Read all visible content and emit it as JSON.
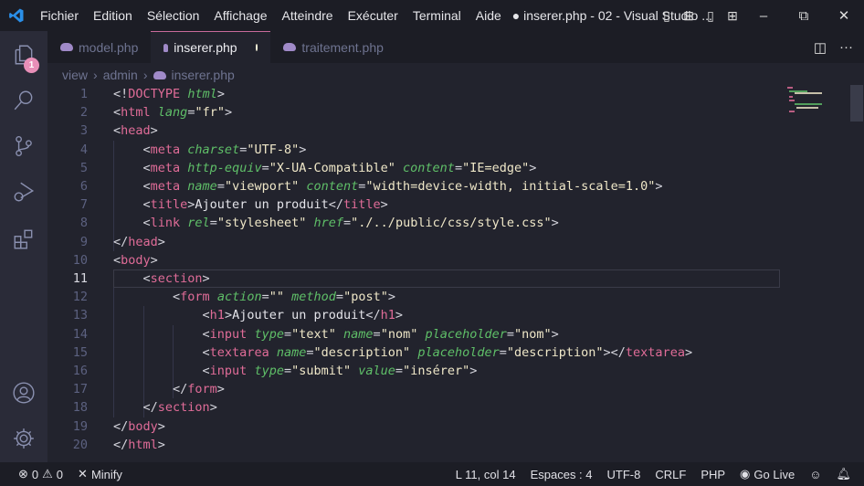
{
  "titlebar": {
    "menu": [
      "Fichier",
      "Edition",
      "Sélection",
      "Affichage",
      "Atteindre",
      "Exécuter",
      "Terminal",
      "Aide"
    ],
    "window_title": "● inserer.php - 02 - Visual Studio ..."
  },
  "activity": {
    "explorer_badge": "1"
  },
  "tabs": [
    {
      "label": "model.php"
    },
    {
      "label": "inserer.php",
      "modified": true
    },
    {
      "label": "traitement.php"
    }
  ],
  "breadcrumb": [
    "view",
    "admin",
    "inserer.php"
  ],
  "colors": {
    "tag": "#e06c98",
    "attr": "#5fbf68",
    "string": "#efe7c8",
    "accent": "#c86a9a"
  },
  "editor": {
    "current_line": 11,
    "lines": [
      [
        [
          "p",
          "<!"
        ],
        [
          "tag",
          "DOCTYPE"
        ],
        [
          "p",
          " "
        ],
        [
          "attr",
          "html"
        ],
        [
          "p",
          ">"
        ]
      ],
      [
        [
          "p",
          "<"
        ],
        [
          "tag",
          "html"
        ],
        [
          "p",
          " "
        ],
        [
          "attr",
          "lang"
        ],
        [
          "p",
          "="
        ],
        [
          "str",
          "\"fr\""
        ],
        [
          "p",
          ">"
        ]
      ],
      [
        [
          "p",
          "<"
        ],
        [
          "tag",
          "head"
        ],
        [
          "p",
          ">"
        ]
      ],
      [
        [
          "p",
          "    <"
        ],
        [
          "tag",
          "meta"
        ],
        [
          "p",
          " "
        ],
        [
          "attr",
          "charset"
        ],
        [
          "p",
          "="
        ],
        [
          "str",
          "\"UTF-8\""
        ],
        [
          "p",
          ">"
        ]
      ],
      [
        [
          "p",
          "    <"
        ],
        [
          "tag",
          "meta"
        ],
        [
          "p",
          " "
        ],
        [
          "attr",
          "http-equiv"
        ],
        [
          "p",
          "="
        ],
        [
          "str",
          "\"X-UA-Compatible\""
        ],
        [
          "p",
          " "
        ],
        [
          "attr",
          "content"
        ],
        [
          "p",
          "="
        ],
        [
          "str",
          "\"IE=edge\""
        ],
        [
          "p",
          ">"
        ]
      ],
      [
        [
          "p",
          "    <"
        ],
        [
          "tag",
          "meta"
        ],
        [
          "p",
          " "
        ],
        [
          "attr",
          "name"
        ],
        [
          "p",
          "="
        ],
        [
          "str",
          "\"viewport\""
        ],
        [
          "p",
          " "
        ],
        [
          "attr",
          "content"
        ],
        [
          "p",
          "="
        ],
        [
          "str",
          "\"width=device-width, initial-scale=1.0\""
        ],
        [
          "p",
          ">"
        ]
      ],
      [
        [
          "p",
          "    <"
        ],
        [
          "tag",
          "title"
        ],
        [
          "p",
          ">"
        ],
        [
          "txt",
          "Ajouter un produit"
        ],
        [
          "p",
          "</"
        ],
        [
          "tag",
          "title"
        ],
        [
          "p",
          ">"
        ]
      ],
      [
        [
          "p",
          "    <"
        ],
        [
          "tag",
          "link"
        ],
        [
          "p",
          " "
        ],
        [
          "attr",
          "rel"
        ],
        [
          "p",
          "="
        ],
        [
          "str",
          "\"stylesheet\""
        ],
        [
          "p",
          " "
        ],
        [
          "attr",
          "href"
        ],
        [
          "p",
          "="
        ],
        [
          "str",
          "\"./../public/css/style.css\""
        ],
        [
          "p",
          ">"
        ]
      ],
      [
        [
          "p",
          "</"
        ],
        [
          "tag",
          "head"
        ],
        [
          "p",
          ">"
        ]
      ],
      [
        [
          "p",
          "<"
        ],
        [
          "tag",
          "body"
        ],
        [
          "p",
          ">"
        ]
      ],
      [
        [
          "p",
          "    <"
        ],
        [
          "tag",
          "section"
        ],
        [
          "p",
          ">"
        ]
      ],
      [
        [
          "p",
          "        <"
        ],
        [
          "tag",
          "form"
        ],
        [
          "p",
          " "
        ],
        [
          "attr",
          "action"
        ],
        [
          "p",
          "="
        ],
        [
          "str",
          "\"\""
        ],
        [
          "p",
          " "
        ],
        [
          "attr",
          "method"
        ],
        [
          "p",
          "="
        ],
        [
          "str",
          "\"post\""
        ],
        [
          "p",
          ">"
        ]
      ],
      [
        [
          "p",
          "            <"
        ],
        [
          "tag",
          "h1"
        ],
        [
          "p",
          ">"
        ],
        [
          "txt",
          "Ajouter un produit"
        ],
        [
          "p",
          "</"
        ],
        [
          "tag",
          "h1"
        ],
        [
          "p",
          ">"
        ]
      ],
      [
        [
          "p",
          "            <"
        ],
        [
          "tag",
          "input"
        ],
        [
          "p",
          " "
        ],
        [
          "attr",
          "type"
        ],
        [
          "p",
          "="
        ],
        [
          "str",
          "\"text\""
        ],
        [
          "p",
          " "
        ],
        [
          "attr",
          "name"
        ],
        [
          "p",
          "="
        ],
        [
          "str",
          "\"nom\""
        ],
        [
          "p",
          " "
        ],
        [
          "attr",
          "placeholder"
        ],
        [
          "p",
          "="
        ],
        [
          "str",
          "\"nom\""
        ],
        [
          "p",
          ">"
        ]
      ],
      [
        [
          "p",
          "            <"
        ],
        [
          "tag",
          "textarea"
        ],
        [
          "p",
          " "
        ],
        [
          "attr",
          "name"
        ],
        [
          "p",
          "="
        ],
        [
          "str",
          "\"description\""
        ],
        [
          "p",
          " "
        ],
        [
          "attr",
          "placeholder"
        ],
        [
          "p",
          "="
        ],
        [
          "str",
          "\"description\""
        ],
        [
          "p",
          "></"
        ],
        [
          "tag",
          "textarea"
        ],
        [
          "p",
          ">"
        ]
      ],
      [
        [
          "p",
          "            <"
        ],
        [
          "tag",
          "input"
        ],
        [
          "p",
          " "
        ],
        [
          "attr",
          "type"
        ],
        [
          "p",
          "="
        ],
        [
          "str",
          "\"submit\""
        ],
        [
          "p",
          " "
        ],
        [
          "attr",
          "value"
        ],
        [
          "p",
          "="
        ],
        [
          "str",
          "\"insérer\""
        ],
        [
          "p",
          ">"
        ]
      ],
      [
        [
          "p",
          "        </"
        ],
        [
          "tag",
          "form"
        ],
        [
          "p",
          ">"
        ]
      ],
      [
        [
          "p",
          "    </"
        ],
        [
          "tag",
          "section"
        ],
        [
          "p",
          ">"
        ]
      ],
      [
        [
          "p",
          "</"
        ],
        [
          "tag",
          "body"
        ],
        [
          "p",
          ">"
        ]
      ],
      [
        [
          "p",
          "</"
        ],
        [
          "tag",
          "html"
        ],
        [
          "p",
          ">"
        ]
      ]
    ]
  },
  "status": {
    "errors": "0",
    "warnings": "0",
    "minify": "Minify",
    "position": "L 11, col 14",
    "spaces": "Espaces : 4",
    "encoding": "UTF-8",
    "eol": "CRLF",
    "language": "PHP",
    "golive": "Go Live"
  }
}
